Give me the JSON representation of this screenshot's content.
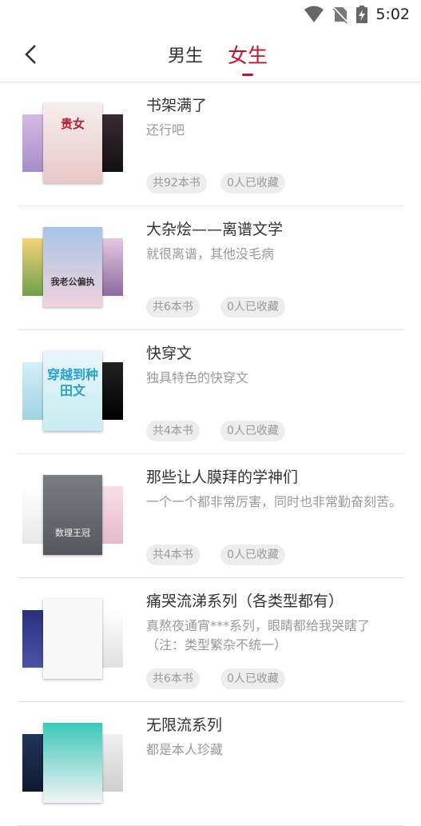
{
  "status_bar": {
    "time": "5:02"
  },
  "header": {
    "tabs": [
      {
        "label": "男生"
      },
      {
        "label": "女生"
      }
    ],
    "active_tab": "女生",
    "accent_color": "#c2152b"
  },
  "lists": [
    {
      "title": "书架满了",
      "description": "还行吧",
      "book_count": "共92本书",
      "favorites": "0人已收藏",
      "cover_text": "贵女",
      "cover_colors": [
        "#c8a0d8",
        "#f2e7e6",
        "#2a2a2a"
      ]
    },
    {
      "title": "大杂烩——离谱文学",
      "description": "就很离谱，其他没毛病",
      "book_count": "共6本书",
      "favorites": "0人已收藏",
      "cover_text": "我老公偏执",
      "cover_colors": [
        "#f0b860",
        "#8fb2d8",
        "#d4a8c8"
      ]
    },
    {
      "title": "快穿文",
      "description": "独具特色的快穿文",
      "book_count": "共4本书",
      "favorites": "0人已收藏",
      "cover_text": "穿越到种田文",
      "cover_colors": [
        "#bfe2ef",
        "#dcf3f6",
        "#1a1a1a"
      ]
    },
    {
      "title": "那些让人膜拜的学神们",
      "description": "一个一个都非常厉害，同时也非常勤奋刻苦。",
      "book_count": "共4本书",
      "favorites": "0人已收藏",
      "cover_text": "数理王冠",
      "cover_colors": [
        "#f4f4f4",
        "#6a6e72",
        "#f0c8d8"
      ]
    },
    {
      "title": "痛哭流涕系列（各类型都有）",
      "description": "真熬夜通宵***系列，眼睛都给我哭瞎了（注：类型繁杂不统一）",
      "book_count": "共6本书",
      "favorites": "0人已收藏",
      "cover_text": "",
      "cover_colors": [
        "#3a3e88",
        "#f8f8f8",
        "#f0f0f0"
      ]
    },
    {
      "title": "无限流系列",
      "description": "都是本人珍藏",
      "book_count": "",
      "favorites": "",
      "cover_text": "",
      "cover_colors": [
        "#1a2a48",
        "#2fbfb0",
        "#e8e8e8"
      ]
    }
  ]
}
